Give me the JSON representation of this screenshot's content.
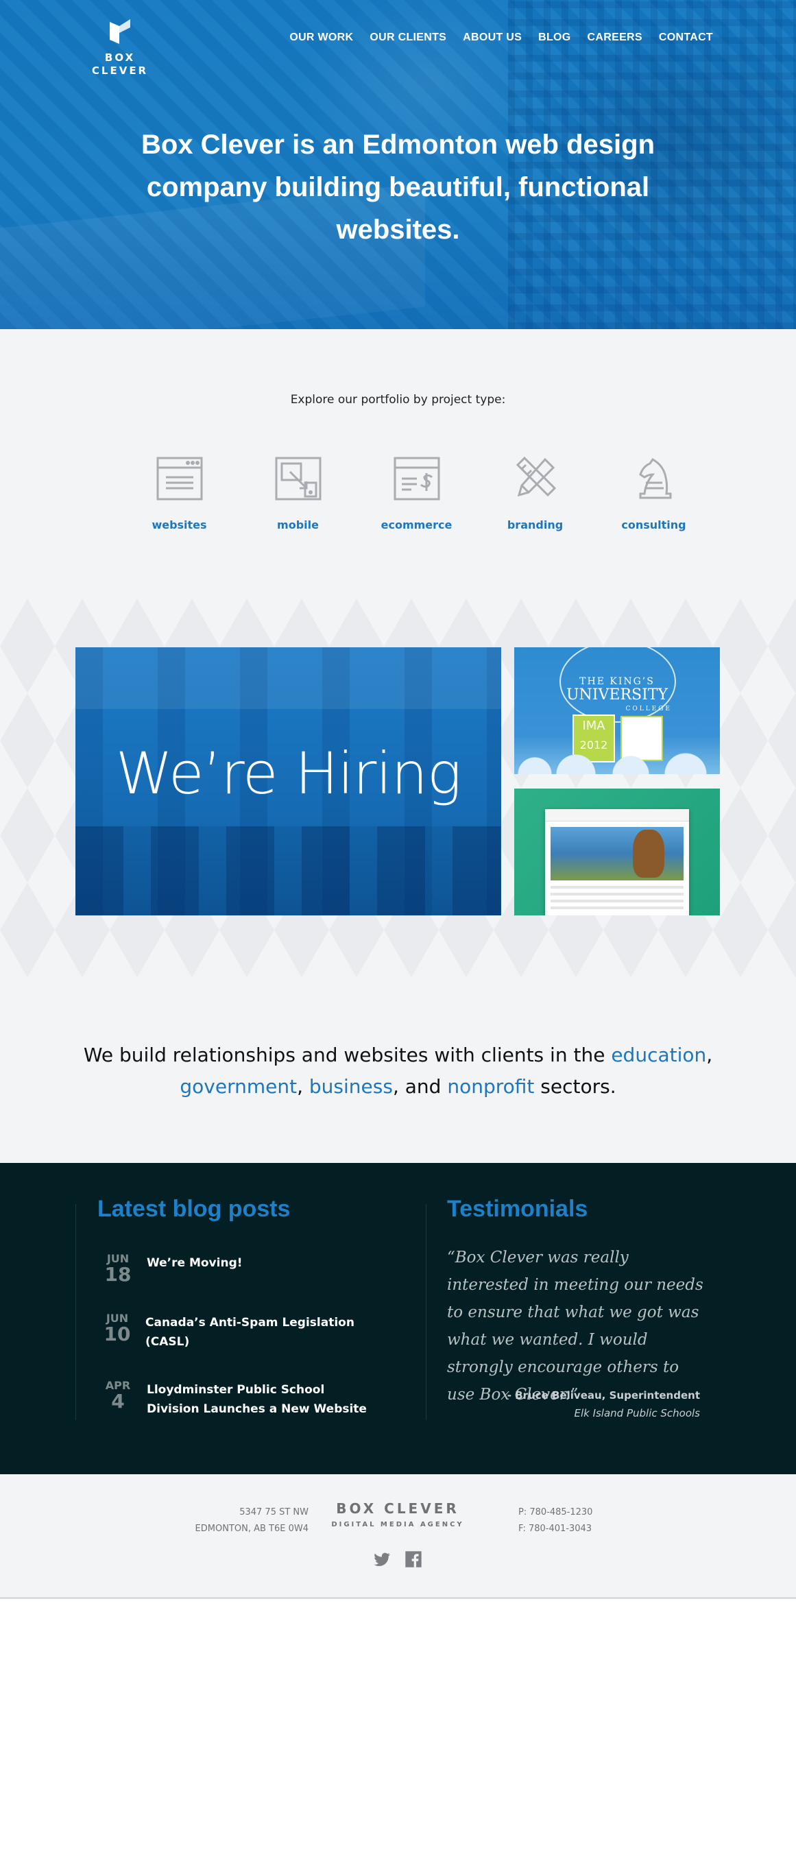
{
  "brand": {
    "name": "BOX CLEVER"
  },
  "nav": [
    "OUR WORK",
    "OUR CLIENTS",
    "ABOUT US",
    "BLOG",
    "CAREERS",
    "CONTACT"
  ],
  "hero": {
    "title": "Box Clever is an Edmonton web design company building beautiful, functional websites."
  },
  "portfolio": {
    "lead": "Explore our portfolio by project type:",
    "types": [
      {
        "label": "websites",
        "icon": "browser-window-icon"
      },
      {
        "label": "mobile",
        "icon": "mobile-resize-icon"
      },
      {
        "label": "ecommerce",
        "icon": "ecommerce-dollar-icon"
      },
      {
        "label": "branding",
        "icon": "pencil-ruler-icon"
      },
      {
        "label": "consulting",
        "icon": "chess-knight-icon"
      }
    ]
  },
  "showcase": {
    "hiring": "We’re Hiring",
    "kings": {
      "line1": "THE KING’S",
      "line2": "UNIVERSITY",
      "line3": "COLLEGE",
      "badge1": "IMA",
      "badge2": "2012"
    }
  },
  "clients": {
    "part1": "We build relationships and websites with clients in the ",
    "education": "education",
    "sep1": ", ",
    "government": "government",
    "sep2": ", ",
    "business": "business",
    "sep3": ", and ",
    "nonprofit": "nonprofit",
    "part2": " sectors."
  },
  "blog": {
    "heading": "Latest blog posts",
    "posts": [
      {
        "mon": "JUN",
        "day": "18",
        "title": "We’re Moving!"
      },
      {
        "mon": "JUN",
        "day": "10",
        "title": "Canada’s Anti-Spam Legislation (CASL)"
      },
      {
        "mon": "APR",
        "day": "4",
        "title": "Lloydminster Public School Division Launches a New Website"
      }
    ]
  },
  "testimonials": {
    "heading": "Testimonials",
    "quote": "“Box Clever was really interested in meeting our needs to ensure that what we got was what we wanted. I would strongly encourage others to use Box Clever.”",
    "name": "- Bruce Beliveau, Superintendent",
    "org": "Elk Island Public Schools"
  },
  "footer": {
    "addr1": "5347 75 ST NW",
    "addr2": "EDMONTON, AB T6E 0W4",
    "brand": "BOX CLEVER",
    "tagline": "DIGITAL MEDIA AGENCY",
    "phone": "P: 780-485-1230",
    "fax": "F: 780-401-3043"
  },
  "colors": {
    "accent": "#1d77be",
    "dark": "#041f24",
    "hero": "#1a7ec3"
  }
}
